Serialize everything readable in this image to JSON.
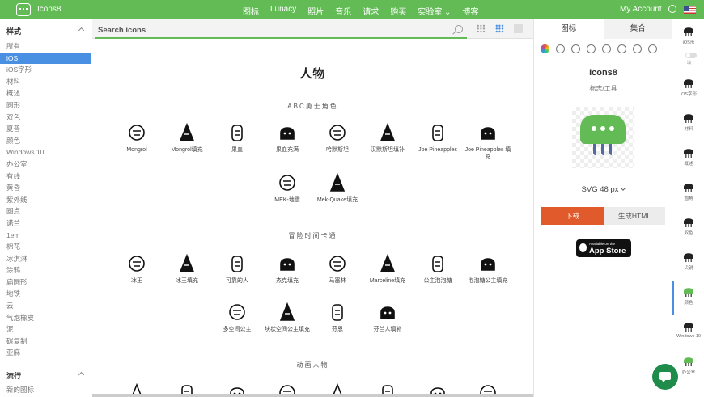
{
  "topbar": {
    "brand": "Icons8",
    "nav": [
      "图标",
      "Lunacy",
      "照片",
      "音乐",
      "请求",
      "购买",
      "实验室 ⌄",
      "博客"
    ],
    "account": "My Account"
  },
  "sidebar": {
    "styles_title": "样式",
    "styles": [
      "所有",
      "iOS",
      "iOS字形",
      "材料",
      "概述",
      "圆形",
      "双色",
      "夏普",
      "颜色",
      "Windows 10",
      "办公室",
      "有线",
      "黄昏",
      "紫外线",
      "圆点",
      "诺兰",
      "1em",
      "棉花",
      "冰淇淋",
      "涂鸦",
      "扁圆形",
      "地铁",
      "云",
      "气泡橡皮",
      "泥",
      "碳复制",
      "亚麻"
    ],
    "active_index": 1,
    "trending_title": "流行",
    "trending": [
      "新的图标"
    ]
  },
  "search": {
    "placeholder": "Search icons"
  },
  "content": {
    "title": "人物",
    "sections": [
      {
        "title": "ABC勇士角色",
        "icons": [
          {
            "label": "Mongrol"
          },
          {
            "label": "Mongrol填充"
          },
          {
            "label": "果血"
          },
          {
            "label": "果血充满"
          },
          {
            "label": "哈默斯坦"
          },
          {
            "label": "汉默斯坦填补"
          },
          {
            "label": "Joe Pineapples"
          },
          {
            "label": "Joe Pineapples 填充"
          },
          {
            "label": "MEK-地震"
          },
          {
            "label": "Mek-Quake填充"
          }
        ]
      },
      {
        "title": "冒险时间卡通",
        "icons": [
          {
            "label": "冰王"
          },
          {
            "label": "冰王填充"
          },
          {
            "label": "可靠的人"
          },
          {
            "label": "杰克填充"
          },
          {
            "label": "马塞林"
          },
          {
            "label": "Marceline填充"
          },
          {
            "label": "公主泡泡糖"
          },
          {
            "label": "泡泡糖公主填充"
          },
          {
            "label": "多空间公主"
          },
          {
            "label": "块状空间公主填充"
          },
          {
            "label": "芬恩"
          },
          {
            "label": "芬兰人填补"
          }
        ]
      },
      {
        "title": "动画人物",
        "icons": []
      }
    ]
  },
  "panel": {
    "tabs": [
      "图标",
      "集合"
    ],
    "name": "Icons8",
    "category": "标志/工具",
    "size": "SVG 48 px",
    "download": "下载",
    "generate_html": "生成HTML",
    "appstore_small": "Available on the",
    "appstore_big": "App Store"
  },
  "farright": {
    "items": [
      "iOS形",
      "iOS字形",
      "材料",
      "概述",
      "圆角",
      "双色",
      "尖锐",
      "颜色",
      "Windows 10",
      "办公室"
    ],
    "toggle_label": "填"
  },
  "colors": {
    "brand_green": "#62bb55",
    "download_orange": "#e05a2b",
    "active_blue": "#4a90e2"
  }
}
